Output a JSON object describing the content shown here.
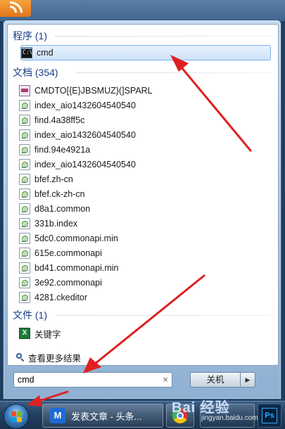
{
  "groups": {
    "programs": {
      "header": "程序 (1)",
      "items": [
        {
          "label": "cmd",
          "icon": "cmd-icon",
          "selected": true
        }
      ]
    },
    "documents": {
      "header": "文档 (354)",
      "items": [
        {
          "label": "CMDTO[{E}JBSMUZ}(]SPARL",
          "icon": "mht-icon"
        },
        {
          "label": "index_aio1432604540540",
          "icon": "document-icon"
        },
        {
          "label": "find.4a38ff5c",
          "icon": "document-icon"
        },
        {
          "label": "index_aio1432604540540",
          "icon": "document-icon"
        },
        {
          "label": "find.94e4921a",
          "icon": "document-icon"
        },
        {
          "label": "index_aio1432604540540",
          "icon": "document-icon"
        },
        {
          "label": "bfef.zh-cn",
          "icon": "document-icon"
        },
        {
          "label": "bfef.ck-zh-cn",
          "icon": "document-icon"
        },
        {
          "label": "d8a1.common",
          "icon": "document-icon"
        },
        {
          "label": "331b.index",
          "icon": "document-icon"
        },
        {
          "label": "5dc0.commonapi.min",
          "icon": "document-icon"
        },
        {
          "label": "615e.commonapi",
          "icon": "document-icon"
        },
        {
          "label": "bd41.commonapi.min",
          "icon": "document-icon"
        },
        {
          "label": "3e92.commonapi",
          "icon": "document-icon"
        },
        {
          "label": "4281.ckeditor",
          "icon": "document-icon"
        }
      ]
    },
    "files": {
      "header": "文件 (1)",
      "items": [
        {
          "label": "关键字",
          "icon": "excel-icon"
        }
      ]
    }
  },
  "see_more": {
    "label": "查看更多结果",
    "icon": "magnifier-icon"
  },
  "search": {
    "value": "cmd",
    "clear_glyph": "×"
  },
  "shutdown": {
    "label": "关机",
    "arrow_glyph": "▶"
  },
  "taskbar": {
    "toutiao_label": "发表文章 - 头条...",
    "toutiao_glyph": "M",
    "ps_glyph": "Ps"
  },
  "icons": {
    "cmd_glyph": "C:\\",
    "excel_glyph": "X"
  },
  "watermark": {
    "main": "Bai 经验",
    "sub": "jingyan.baidu.com"
  },
  "colors": {
    "group_header": "#1a3e8a",
    "selection_fill": "#cde3f8",
    "selection_border": "#7eb4ea",
    "annotation_arrow": "#e02020",
    "taskbar": "#22405f"
  }
}
